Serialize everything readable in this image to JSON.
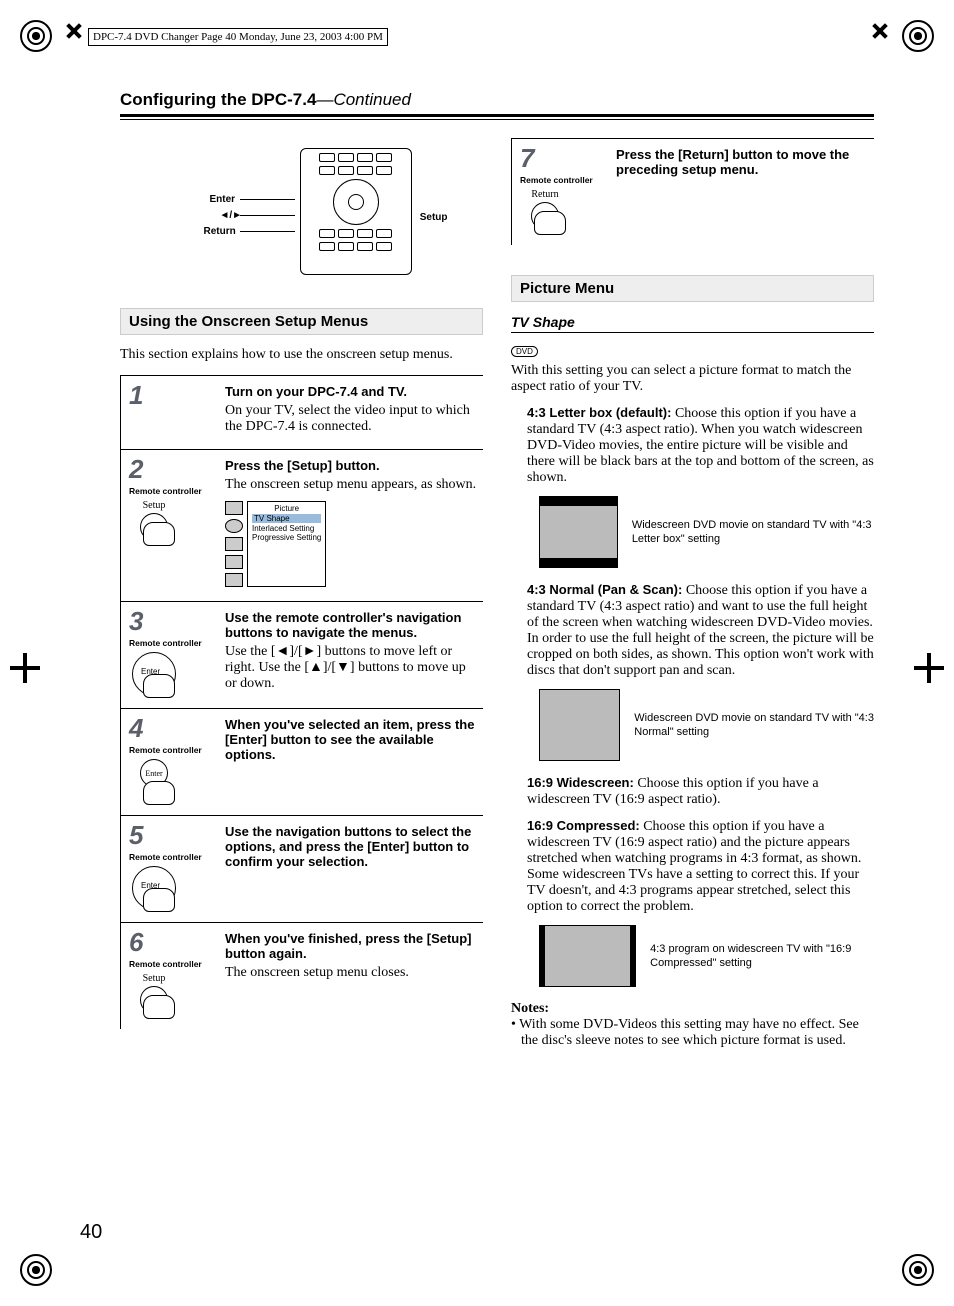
{
  "print_header": "DPC-7.4 DVD Changer Page 40  Monday, June 23, 2003  4:00 PM",
  "section_title_main": "Configuring the DPC-7.4",
  "section_title_cont": "—Continued",
  "remote_labels": {
    "enter": "Enter",
    "nav": "◄/►",
    "return": "Return",
    "setup": "Setup",
    "updown_hint": "▲ ▼"
  },
  "left": {
    "heading": "Using the Onscreen Setup Menus",
    "intro": "This section explains how to use the onscreen setup menus.",
    "rc_label": "Remote controller",
    "steps": [
      {
        "num": "1",
        "bold": "Turn on your DPC-7.4 and TV.",
        "body": "On your TV, select the video input to which the DPC-7.4 is connected.",
        "icon": "none"
      },
      {
        "num": "2",
        "bold": "Press the [Setup] button.",
        "body": "The onscreen setup menu appears, as shown.",
        "icon": "setup",
        "btn_cap": "Setup",
        "osd": {
          "title": "Picture",
          "items": [
            "TV Shape",
            "Interlaced Setting",
            "Progressive Setting"
          ]
        }
      },
      {
        "num": "3",
        "bold": "Use the remote controller's navigation buttons to navigate the menus.",
        "body": "Use the [◄]/[►] buttons to move left or right. Use the [▲]/[▼] buttons to move up or down.",
        "icon": "dpad"
      },
      {
        "num": "4",
        "bold": "When you've selected an item, press the [Enter] button to see the available options.",
        "body": "",
        "icon": "enter",
        "btn_cap": "Enter"
      },
      {
        "num": "5",
        "bold": "Use the navigation buttons to select the options, and press the [Enter] button to confirm your selection.",
        "body": "",
        "icon": "dpad"
      },
      {
        "num": "6",
        "bold": "When you've finished, press the [Setup] button again.",
        "body": "The onscreen setup menu closes.",
        "icon": "setup",
        "btn_cap": "Setup"
      }
    ]
  },
  "right": {
    "step7": {
      "num": "7",
      "rc_label": "Remote controller",
      "btn_cap": "Return",
      "bold": "Press the [Return] button to move the preceding setup menu."
    },
    "heading": "Picture Menu",
    "sub": "TV Shape",
    "dvd_badge": "DVD",
    "intro": "With this setting you can select a picture format to match the aspect ratio of your TV.",
    "opts": [
      {
        "label": "4:3 Letter box (default):",
        "text": " Choose this option if you have a standard TV (4:3 aspect ratio). When you watch widescreen DVD-Video movies, the entire picture will be visible and there will be black bars at the top and bottom of the screen, as shown.",
        "fig": "letterbox",
        "caption": "Widescreen DVD movie on standard TV with \"4:3 Letter box\" setting"
      },
      {
        "label": "4:3 Normal (Pan & Scan):",
        "text": " Choose this option if you have a standard TV (4:3 aspect ratio) and want to use the full height of the screen when watching widescreen DVD-Video movies. In order to use the full height of the screen, the picture will be cropped on both sides, as shown. This option won't work with discs that don't support pan and scan.",
        "fig": "normal",
        "caption": "Widescreen DVD movie on standard TV with \"4:3 Normal\" setting"
      },
      {
        "label": "16:9 Widescreen:",
        "text": " Choose this option if you have a widescreen TV (16:9 aspect ratio).",
        "fig": "",
        "caption": ""
      },
      {
        "label": "16:9 Compressed:",
        "text": " Choose this option if you have a widescreen TV (16:9 aspect ratio) and the picture appears stretched when watching programs in 4:3 format, as shown. Some widescreen TVs have a setting to correct this. If your TV doesn't, and 4:3 programs appear stretched, select this option to correct the problem.",
        "fig": "compressed",
        "caption": "4:3 program on widescreen TV with \"16:9 Compressed\" setting"
      }
    ],
    "notes_h": "Notes:",
    "notes": [
      "With some DVD-Videos this setting may have no effect. See the disc's sleeve notes to see which picture format is used."
    ]
  },
  "page_number": "40"
}
